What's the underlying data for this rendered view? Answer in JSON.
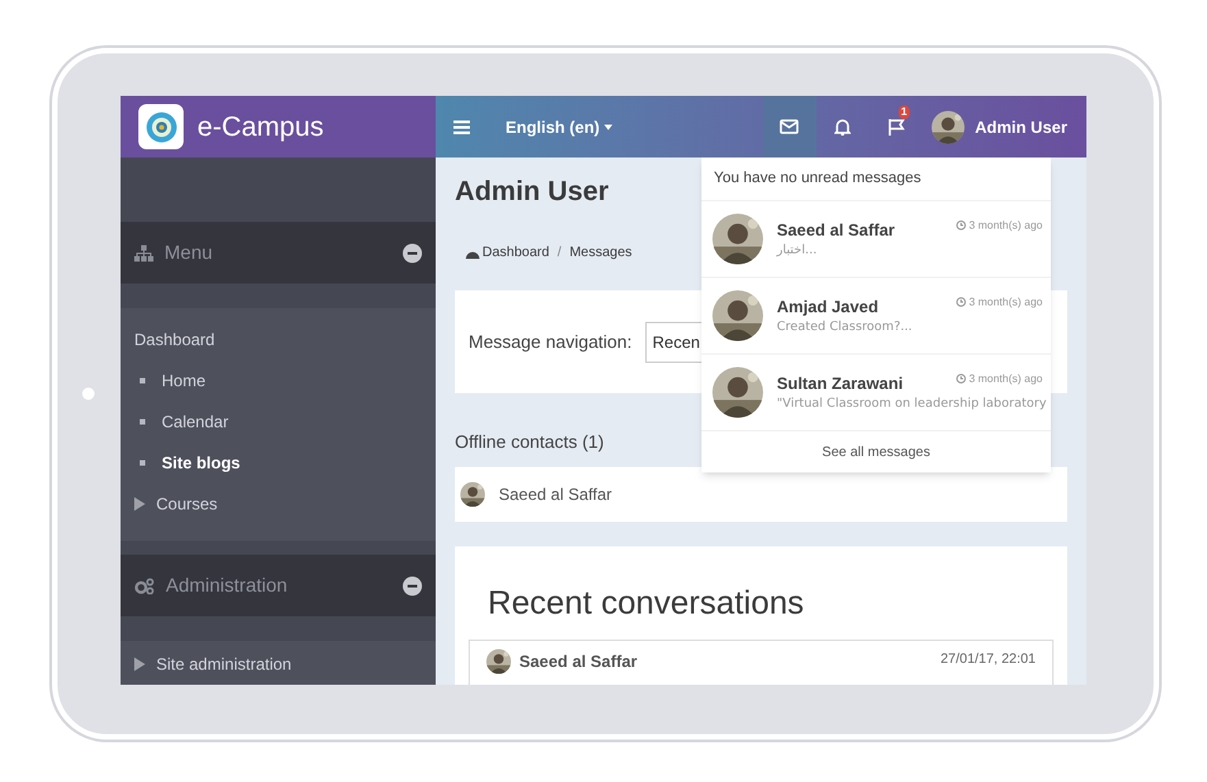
{
  "brand": {
    "name": "e-Campus"
  },
  "topbar": {
    "language": "English (en)",
    "icons": [
      {
        "kind": "mail",
        "selected": true
      },
      {
        "kind": "bell",
        "selected": false
      },
      {
        "kind": "flag",
        "selected": false,
        "badge": "1"
      }
    ],
    "user": "Admin User"
  },
  "sidebar": {
    "blocks": [
      {
        "title": "Menu",
        "kind": "sitemap",
        "items": [
          {
            "label": "Dashboard",
            "kind": "heading",
            "selected": false
          },
          {
            "label": "Home",
            "kind": "bullet",
            "selected": false
          },
          {
            "label": "Calendar",
            "kind": "bullet",
            "selected": false
          },
          {
            "label": "Site blogs",
            "kind": "bullet",
            "selected": true
          },
          {
            "label": "Courses",
            "kind": "arrow",
            "selected": false
          }
        ]
      },
      {
        "title": "Administration",
        "kind": "gears",
        "items": [
          {
            "label": "Site administration",
            "kind": "arrow",
            "selected": false
          }
        ]
      }
    ]
  },
  "page": {
    "title": "Admin User",
    "breadcrumb": [
      "Dashboard",
      "Messages"
    ],
    "breadcrumb_separator": "/",
    "navigation": {
      "label": "Message navigation:",
      "value": "Recen"
    },
    "offline_contacts": {
      "heading": "Offline contacts (1)",
      "contacts": [
        {
          "name": "Saeed al Saffar"
        }
      ]
    },
    "recent": {
      "title": "Recent conversations",
      "items": [
        {
          "name": "Saeed al Saffar",
          "time": "27/01/17, 22:01"
        }
      ]
    }
  },
  "messages_dropdown": {
    "header": "You have no unread messages",
    "messages": [
      {
        "name": "Saeed al Saffar",
        "time": "3 month(s) ago",
        "preview": "اختبار..."
      },
      {
        "name": "Amjad Javed",
        "time": "3 month(s) ago",
        "preview": "Created Classroom?..."
      },
      {
        "name": "Sultan Zarawani",
        "time": "3 month(s) ago",
        "preview": "\"Virtual Classroom on leadership laboratory"
      }
    ],
    "footer": "See all messages"
  }
}
